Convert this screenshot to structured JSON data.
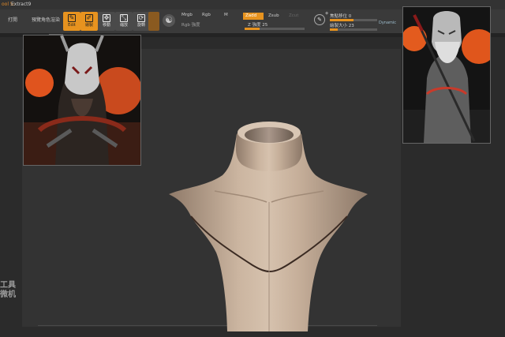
{
  "titlebar": {
    "prefix": "ool 5:",
    "document": "Extract9"
  },
  "toolbar": {
    "open_label": "打開",
    "preview_label": "預覽角色渲染",
    "tools": [
      {
        "name": "edit",
        "label": "Edit",
        "glyph": "✎"
      },
      {
        "name": "draw",
        "label": "繪製",
        "glyph": "✐"
      },
      {
        "name": "move",
        "label": "移動",
        "glyph": "✥"
      },
      {
        "name": "scale",
        "label": "縮放",
        "glyph": "⤡"
      },
      {
        "name": "rotate",
        "label": "旋轉",
        "glyph": "⟳"
      }
    ],
    "mrgb": "Mrgb",
    "rgb": "Rgb",
    "m": "M",
    "rgb_intensity": "Rgb 強度",
    "zadd": "Zadd",
    "zsub": "Zsub",
    "zcut": "Zcut",
    "z_intensity": "Z 強度",
    "z_intensity_value": 25,
    "focal_shift": "焦點移位",
    "focal_shift_value": 0,
    "draw_size": "繪製大小",
    "draw_size_value": 23,
    "dynamic": "Dynamic"
  },
  "watermark": {
    "line1": "工具",
    "line2": "微机"
  },
  "colors": {
    "accent": "#e7931f",
    "canvas": "#333333",
    "skin": "#c9b39e"
  }
}
